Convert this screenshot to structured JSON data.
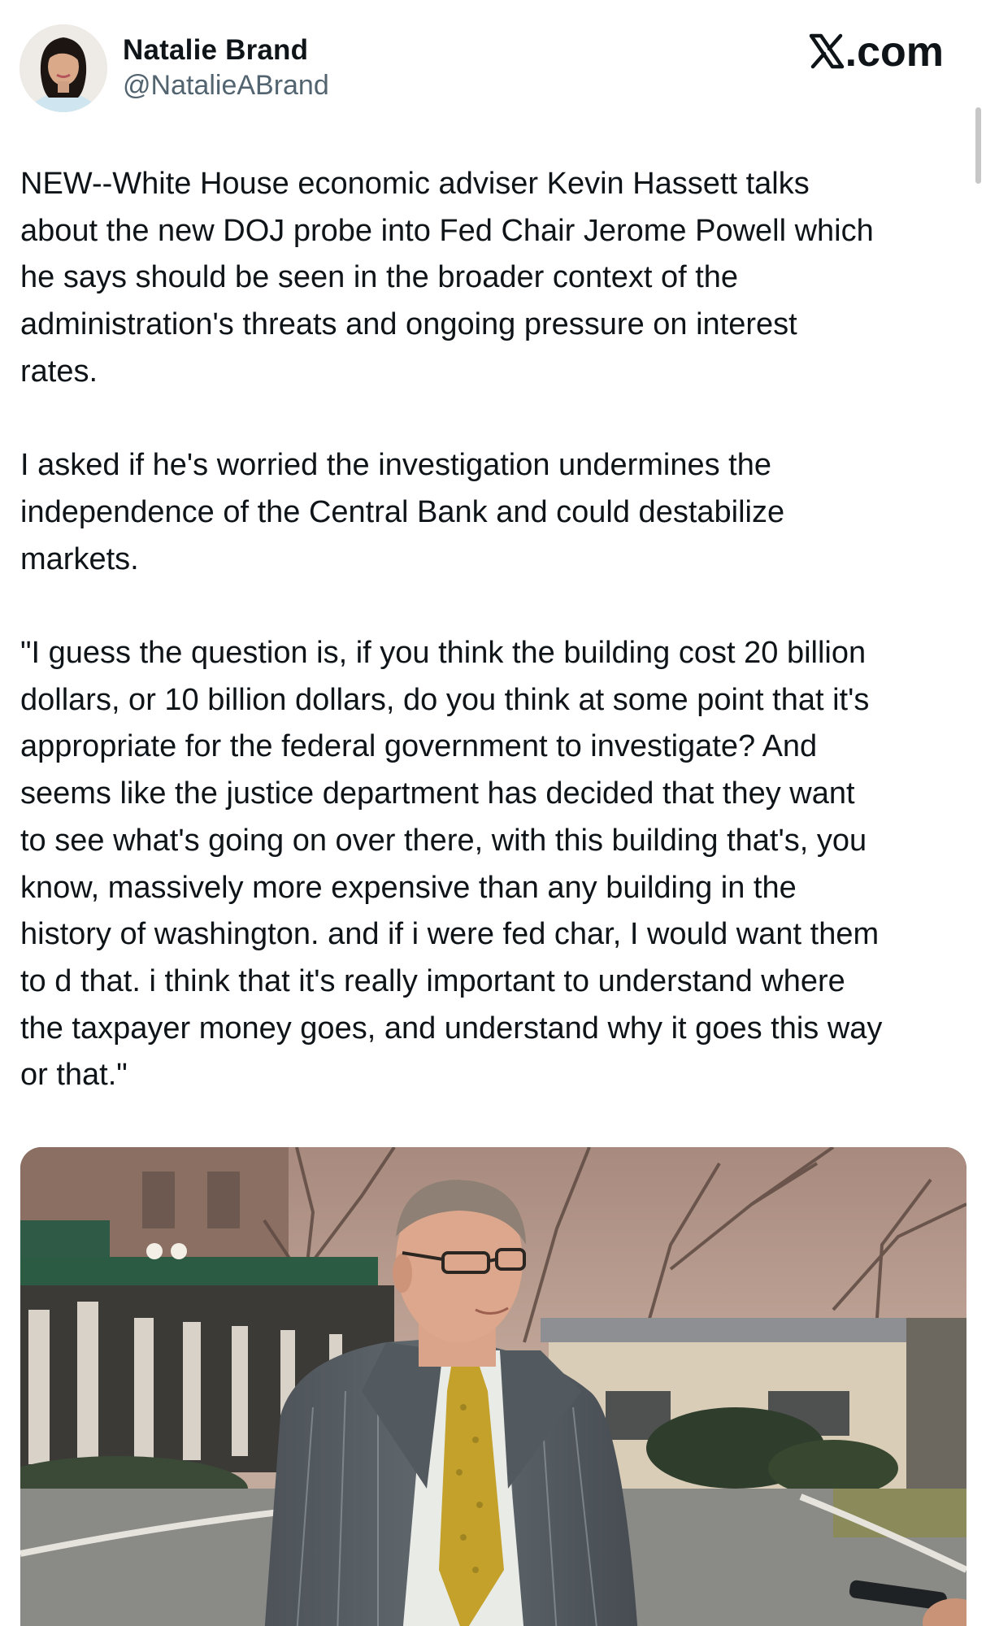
{
  "author": {
    "display_name": "Natalie Brand",
    "handle": "@NatalieABrand",
    "avatar_icon": "profile-avatar"
  },
  "brand": {
    "icon": "x-logo-icon",
    "suffix": ".com"
  },
  "post": {
    "paragraphs": [
      "NEW--White House economic adviser Kevin Hassett talks\nabout the new DOJ probe into Fed Chair Jerome Powell which\nhe says should be seen in the broader context of the\nadministration's threats and ongoing pressure on interest\nrates.",
      "I asked if he's worried the investigation undermines the\nindependence of the Central Bank and could destabilize\nmarkets.",
      "\"I guess the question is, if you think the building cost 20 billion\ndollars, or 10 billion dollars, do you think at some point that it's\nappropriate for the federal government to investigate? And\nseems like the justice department has decided that they want\nto see what's going on over there, with this building that's, you\nknow, massively more expensive than any building in the\nhistory of washington. and if i were fed char, I would want them\nto d that. i think that it's really important to understand where\nthe taxpayer money goes, and understand why it goes this way\nor that.\""
    ]
  },
  "media": {
    "type": "video-still",
    "scene": "man-in-pinstripe-suit-outside-white-house"
  },
  "colors": {
    "text_primary": "#0f1419",
    "text_secondary": "#536471",
    "background": "#ffffff"
  }
}
